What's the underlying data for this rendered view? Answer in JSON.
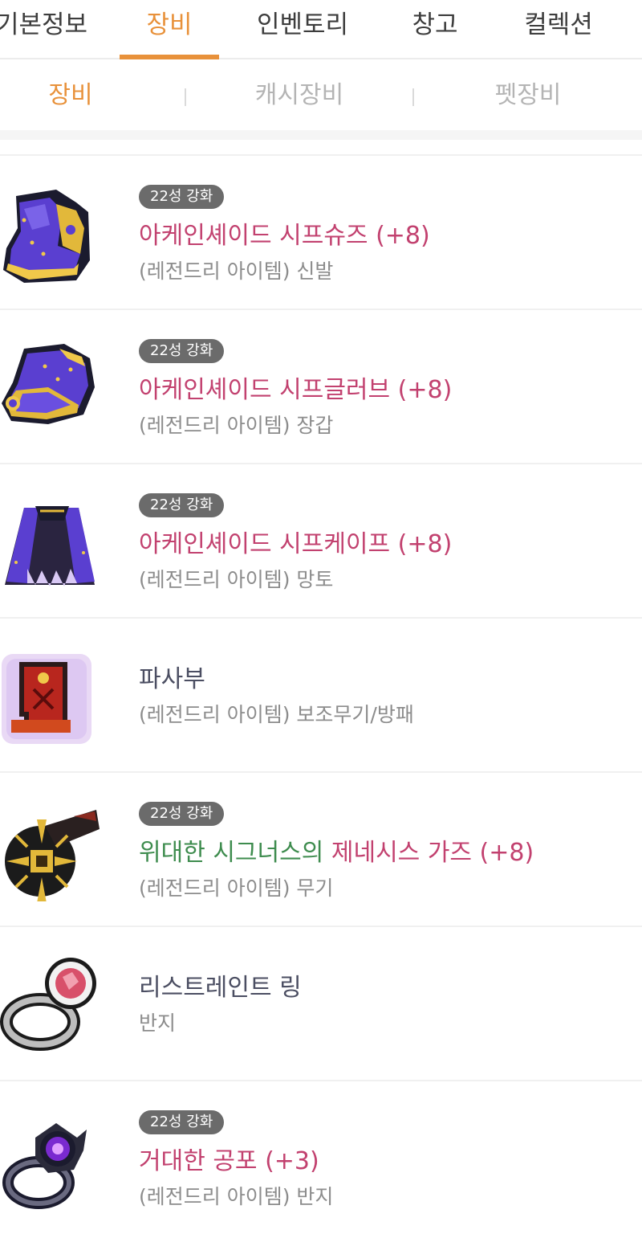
{
  "tabs": [
    {
      "label": "기본정보",
      "active": false
    },
    {
      "label": "장비",
      "active": true
    },
    {
      "label": "인벤토리",
      "active": false
    },
    {
      "label": "창고",
      "active": false
    },
    {
      "label": "컬렉션",
      "active": false
    }
  ],
  "subtabs": [
    {
      "label": "장비",
      "active": true
    },
    {
      "label": "캐시장비",
      "active": false
    },
    {
      "label": "펫장비",
      "active": false
    }
  ],
  "colors": {
    "accent": "#e8913a",
    "item_name_enhanced": "#c2416f",
    "item_name_plain": "#4b4e62",
    "green_name": "#3e8c4e",
    "badge_bg": "#6b6b6b"
  },
  "items": [
    {
      "badge": "22성 강화",
      "name": "아케인셰이드 시프슈즈 (+8)",
      "sub": "(레전드리 아이템) 신발",
      "icon": "shoes-icon"
    },
    {
      "badge": "22성 강화",
      "name": "아케인셰이드 시프글러브 (+8)",
      "sub": "(레전드리 아이템) 장갑",
      "icon": "glove-icon"
    },
    {
      "badge": "22성 강화",
      "name": "아케인셰이드 시프케이프 (+8)",
      "sub": "(레전드리 아이템) 망토",
      "icon": "cape-icon"
    },
    {
      "badge": "",
      "name": "파사부",
      "sub": "(레전드리 아이템) 보조무기/방패",
      "icon": "talisman-icon"
    },
    {
      "badge": "22성 강화",
      "name_green": "위대한 시그너스의",
      "name": " 제네시스 가즈 (+8)",
      "sub": "(레전드리 아이템) 무기",
      "icon": "weapon-icon"
    },
    {
      "badge": "",
      "name": "리스트레인트 링",
      "sub": "반지",
      "icon": "ruby-ring-icon"
    },
    {
      "badge": "22성 강화",
      "name": "거대한 공포 (+3)",
      "sub": "(레전드리 아이템) 반지",
      "icon": "dark-ring-icon"
    }
  ]
}
